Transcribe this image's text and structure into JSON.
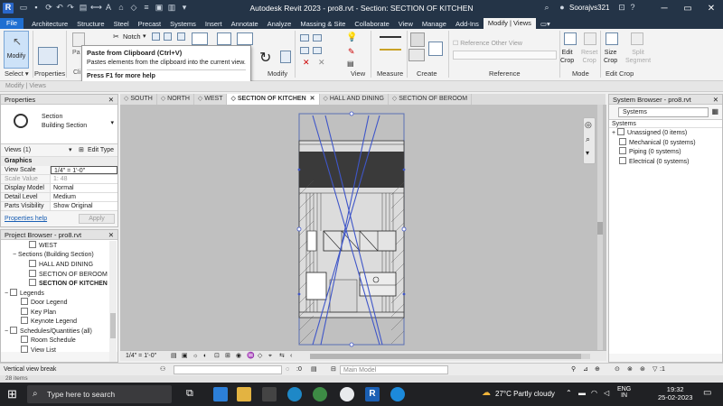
{
  "window": {
    "title": "Autodesk Revit 2023 - pro8.rvt - Section: SECTION OF KITCHEN",
    "user": "Soorajvs321"
  },
  "menu": {
    "file": "File",
    "tabs": [
      "Architecture",
      "Structure",
      "Steel",
      "Precast",
      "Systems",
      "Insert",
      "Annotate",
      "Analyze",
      "Massing & Site",
      "Collaborate",
      "View",
      "Manage",
      "Add-Ins",
      "Modify | Views"
    ],
    "active_tab": "Modify | Views"
  },
  "ribbon": {
    "modify_label": "Modify",
    "notch_label": "Notch",
    "panels": {
      "select": "Select ▾",
      "properties": "Properties",
      "modify": "Modify",
      "view": "View",
      "measure": "Measure",
      "create": "Create",
      "reference": "Reference",
      "mode": "Mode",
      "edit_crop": "Edit Crop"
    },
    "reference_other_view": "Reference Other View",
    "buttons": {
      "edit_crop": "Edit\nCrop",
      "reset_crop": "Reset\nCrop",
      "size_crop": "Size\nCrop",
      "split_segment": "Split\nSegment"
    },
    "clip_label": "Cli",
    "pa_label": "Pa"
  },
  "tooltip": {
    "title": "Paste from Clipboard (Ctrl+V)",
    "description": "Pastes elements from the clipboard into the current view.",
    "help": "Press F1 for more help"
  },
  "options_bar": {
    "text": "Modify | Views"
  },
  "properties": {
    "title": "Properties",
    "type_name": "Section",
    "type_sub": "Building Section",
    "selector": "Views (1)",
    "edit_type": "Edit Type",
    "group": "Graphics",
    "rows": [
      {
        "k": "View Scale",
        "v": "1/4\" = 1'-0\""
      },
      {
        "k": "Scale Value",
        "v": "1: 48",
        "dim": true
      },
      {
        "k": "Display Model",
        "v": "Normal"
      },
      {
        "k": "Detail Level",
        "v": "Medium"
      },
      {
        "k": "Parts Visibility",
        "v": "Show Original"
      }
    ],
    "help": "Properties help",
    "apply": "Apply"
  },
  "project_browser": {
    "title": "Project Browser - pro8.rvt",
    "items": [
      {
        "label": "WEST",
        "indent": 3,
        "box": true
      },
      {
        "label": "Sections (Building Section)",
        "indent": 1,
        "toggle": "−"
      },
      {
        "label": "HALL AND DINING",
        "indent": 3,
        "box": true
      },
      {
        "label": "SECTION OF BEROOM",
        "indent": 3,
        "box": true
      },
      {
        "label": "SECTION OF KITCHEN",
        "indent": 3,
        "box": true,
        "bold": true
      },
      {
        "label": "Legends",
        "indent": 0,
        "toggle": "−",
        "box": true
      },
      {
        "label": "Door Legend",
        "indent": 2,
        "box": true
      },
      {
        "label": "Key Plan",
        "indent": 2,
        "box": true
      },
      {
        "label": "Keynote Legend",
        "indent": 2,
        "box": true
      },
      {
        "label": "Schedules/Quantities (all)",
        "indent": 0,
        "toggle": "−",
        "box": true
      },
      {
        "label": "Room Schedule",
        "indent": 2,
        "box": true
      },
      {
        "label": "View List",
        "indent": 2,
        "box": true
      }
    ]
  },
  "view_tabs": [
    {
      "label": "SOUTH",
      "active": false
    },
    {
      "label": "NORTH",
      "active": false
    },
    {
      "label": "WEST",
      "active": false
    },
    {
      "label": "SECTION OF KITCHEN",
      "active": true,
      "close": "✕"
    },
    {
      "label": "HALL AND DINING",
      "active": false
    },
    {
      "label": "SECTION OF BEROOM",
      "active": false
    }
  ],
  "view_control": {
    "scale": "1/4\" = 1'-0\""
  },
  "system_browser": {
    "title": "System Browser - pro8.rvt",
    "dropdown": "Systems",
    "header": "Systems",
    "items": [
      {
        "label": "Unassigned (0 items)",
        "toggle": "+"
      },
      {
        "label": "Mechanical (0 systems)"
      },
      {
        "label": "Piping (0 systems)"
      },
      {
        "label": "Electrical (0 systems)"
      }
    ]
  },
  "status": {
    "message": "Vertical view break",
    "zero": ":0",
    "model": "Main Model",
    "filter": ":1",
    "items": "28 items"
  },
  "taskbar": {
    "search": "Type here to search",
    "weather": "27°C  Partly cloudy",
    "lang": "ENG",
    "lang_sub": "IN",
    "time": "19:32",
    "date": "25-02-2023"
  }
}
